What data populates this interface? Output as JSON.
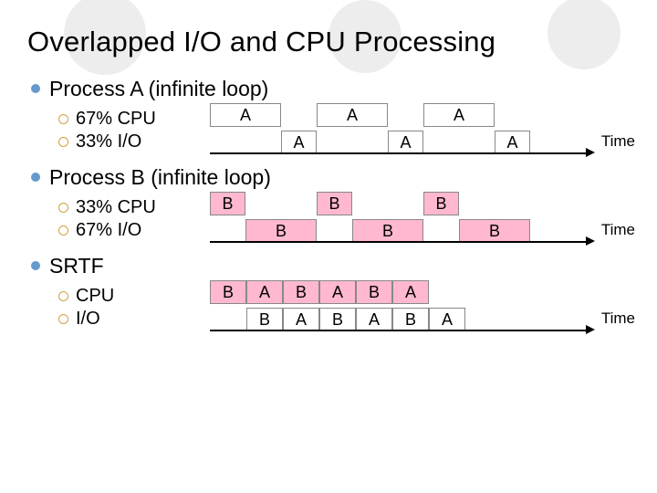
{
  "title": "Overlapped I/O and CPU Processing",
  "time_label": "Time",
  "sections": [
    {
      "heading": "Process A (infinite loop)",
      "subs": [
        "67% CPU",
        "33% I/O"
      ],
      "tracks": [
        {
          "offset": 0,
          "unit": 39,
          "cells": [
            {
              "t": "A",
              "c": "cA-cpu",
              "w": 2
            },
            {
              "t": "",
              "c": "gap",
              "w": 1
            },
            {
              "t": "A",
              "c": "cA-cpu",
              "w": 2
            },
            {
              "t": "",
              "c": "gap",
              "w": 1
            },
            {
              "t": "A",
              "c": "cA-cpu",
              "w": 2
            }
          ]
        },
        {
          "offset": 78,
          "unit": 39,
          "cells": [
            {
              "t": "A",
              "c": "cA-cpu",
              "w": 1
            },
            {
              "t": "",
              "c": "gap",
              "w": 2
            },
            {
              "t": "A",
              "c": "cA-cpu",
              "w": 1
            },
            {
              "t": "",
              "c": "gap",
              "w": 2
            },
            {
              "t": "A",
              "c": "cA-cpu",
              "w": 1
            }
          ],
          "timeline": true
        }
      ]
    },
    {
      "heading": "Process B (infinite loop)",
      "subs": [
        "33% CPU",
        "67% I/O"
      ],
      "tracks": [
        {
          "offset": 0,
          "unit": 39,
          "cells": [
            {
              "t": "B",
              "c": "cB-cpu",
              "w": 1
            },
            {
              "t": "",
              "c": "gap",
              "w": 2
            },
            {
              "t": "B",
              "c": "cB-cpu",
              "w": 1
            },
            {
              "t": "",
              "c": "gap",
              "w": 2
            },
            {
              "t": "B",
              "c": "cB-cpu",
              "w": 1
            }
          ]
        },
        {
          "offset": 39,
          "unit": 39,
          "cells": [
            {
              "t": "B",
              "c": "cB-cpu",
              "w": 2
            },
            {
              "t": "",
              "c": "gap",
              "w": 1
            },
            {
              "t": "B",
              "c": "cB-cpu",
              "w": 2
            },
            {
              "t": "",
              "c": "gap",
              "w": 1
            },
            {
              "t": "B",
              "c": "cB-cpu",
              "w": 2
            }
          ],
          "timeline": true
        }
      ]
    },
    {
      "heading": "SRTF",
      "subs": [
        "CPU",
        "I/O"
      ],
      "tracks": [
        {
          "offset": 0,
          "unit": 40,
          "cells": [
            {
              "t": "B",
              "c": "cB-cpu",
              "w": 1
            },
            {
              "t": "A",
              "c": "cA-pink",
              "w": 1
            },
            {
              "t": "B",
              "c": "cB-cpu",
              "w": 1
            },
            {
              "t": "A",
              "c": "cA-pink",
              "w": 1
            },
            {
              "t": "B",
              "c": "cB-cpu",
              "w": 1
            },
            {
              "t": "A",
              "c": "cA-pink",
              "w": 1
            }
          ]
        },
        {
          "offset": 40,
          "unit": 40,
          "cells": [
            {
              "t": "B",
              "c": "cB-white",
              "w": 1
            },
            {
              "t": "A",
              "c": "cA-cpu",
              "w": 1
            },
            {
              "t": "B",
              "c": "cB-white",
              "w": 1
            },
            {
              "t": "A",
              "c": "cA-cpu",
              "w": 1
            },
            {
              "t": "B",
              "c": "cB-white",
              "w": 1
            },
            {
              "t": "A",
              "c": "cA-cpu",
              "w": 1
            }
          ],
          "timeline": true
        }
      ]
    }
  ]
}
